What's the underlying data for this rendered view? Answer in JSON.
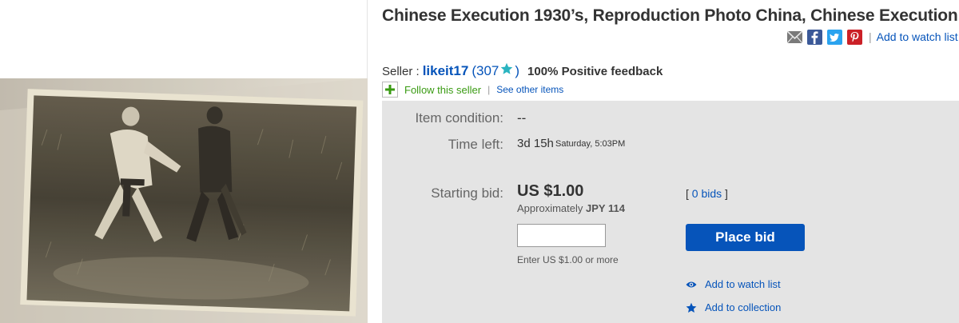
{
  "listing": {
    "title": "Chinese Execution 1930’s, Reproduction Photo China, Chinese Execution"
  },
  "share": {
    "icons": [
      "email-icon",
      "facebook-icon",
      "twitter-icon",
      "pinterest-icon"
    ],
    "separator": "|",
    "watch_label": "Add to watch list"
  },
  "seller": {
    "label": "Seller :",
    "name": "likeit17",
    "score_open": "(307",
    "score_close": ")",
    "positive_feedback": "100% Positive feedback",
    "follow_label": "Follow this seller",
    "separator": "|",
    "see_other_label": "See other items"
  },
  "details": {
    "condition_label": "Item condition:",
    "condition_value": "--",
    "time_left_label": "Time left:",
    "time_left_value": "3d 15h",
    "time_left_end": "Saturday, 5:03PM",
    "starting_bid_label": "Starting bid:",
    "starting_bid_value": "US $1.00",
    "approx_label": "Approximately",
    "approx_value": "JPY 114",
    "bids_open": "[",
    "bids_value": "0 bids",
    "bids_close": "]",
    "bid_input_value": "",
    "enter_hint": "Enter US $1.00 or more",
    "place_bid_label": "Place bid",
    "watch_label": "Add to watch list",
    "collection_label": "Add to collection"
  },
  "colors": {
    "link": "#0654ba",
    "follow_green": "#3a9b13",
    "panel_bg": "#e4e4e4",
    "button_bg": "#0654ba",
    "star": "#2ab4c0"
  }
}
